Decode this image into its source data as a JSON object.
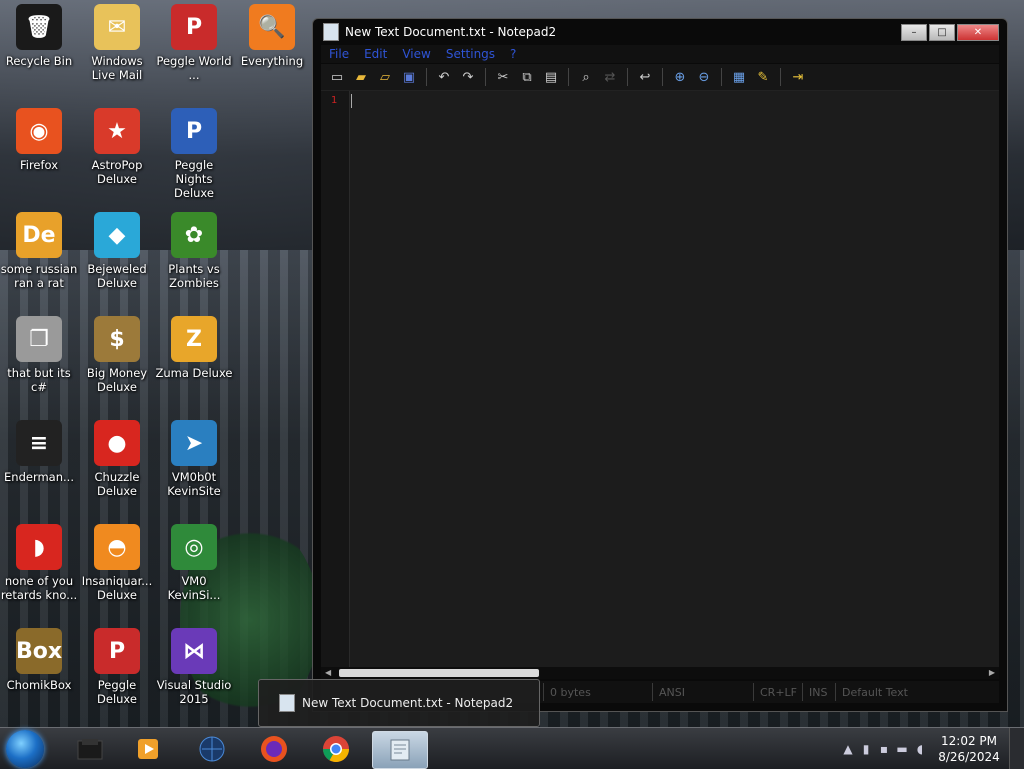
{
  "desktop": {
    "icons": [
      {
        "label": "Recycle Bin",
        "icon": "recycle-bin-icon",
        "color": "#1a1a1a",
        "glyph": "🗑"
      },
      {
        "label": "Windows Live Mail",
        "icon": "mail-icon",
        "color": "#e8c25a",
        "glyph": "✉"
      },
      {
        "label": "Peggle World ...",
        "icon": "peggle-icon",
        "color": "#c92b2b",
        "glyph": "P"
      },
      {
        "label": "Everything",
        "icon": "magnifier-icon",
        "color": "#f07b1f",
        "glyph": "🔍"
      },
      {
        "label": "Firefox",
        "icon": "firefox-icon",
        "color": "#e8521f",
        "glyph": "◉"
      },
      {
        "label": "AstroPop Deluxe",
        "icon": "astropop-icon",
        "color": "#d93a2a",
        "glyph": "★"
      },
      {
        "label": "Peggle Nights Deluxe",
        "icon": "peggle-nights-icon",
        "color": "#2d5fb8",
        "glyph": "P"
      },
      {
        "label": "some russian ran a rat",
        "icon": "de-app-icon",
        "color": "#e8a12a",
        "glyph": "De"
      },
      {
        "label": "Bejeweled Deluxe",
        "icon": "gem-icon",
        "color": "#2aa8d8",
        "glyph": "◆"
      },
      {
        "label": "Plants vs Zombies",
        "icon": "plant-icon",
        "color": "#3a8a2a",
        "glyph": "✿"
      },
      {
        "label": "that but its c#",
        "icon": "windows-stack-icon",
        "color": "#9a9a9a",
        "glyph": "❐"
      },
      {
        "label": "Big Money Deluxe",
        "icon": "money-bag-icon",
        "color": "#9c7a3a",
        "glyph": "$"
      },
      {
        "label": "Zuma Deluxe",
        "icon": "zuma-icon",
        "color": "#e8a62a",
        "glyph": "Z"
      },
      {
        "label": "Enderman...",
        "icon": "console-icon",
        "color": "#222222",
        "glyph": "≡"
      },
      {
        "label": "Chuzzle Deluxe",
        "icon": "chuzzle-icon",
        "color": "#d8261f",
        "glyph": "●"
      },
      {
        "label": "VM0b0t KevinSite",
        "icon": "bird-icon",
        "color": "#2a7fc0",
        "glyph": "➤"
      },
      {
        "label": "none of you retards kno...",
        "icon": "dragon-icon",
        "color": "#d8261f",
        "glyph": "◗"
      },
      {
        "label": "Insaniquar... Deluxe",
        "icon": "fish-icon",
        "color": "#f08a1f",
        "glyph": "◓"
      },
      {
        "label": "VM0 KevinSi...",
        "icon": "chrome-icon",
        "color": "#2f8a3a",
        "glyph": "◎"
      },
      {
        "label": "ChomikBox",
        "icon": "chomikbox-icon",
        "color": "#8a6a2a",
        "glyph": "Box"
      },
      {
        "label": "Peggle Deluxe",
        "icon": "peggle-deluxe-icon",
        "color": "#c92b2b",
        "glyph": "P"
      },
      {
        "label": "Visual Studio 2015",
        "icon": "visual-studio-icon",
        "color": "#6a3ab8",
        "glyph": "⋈"
      }
    ]
  },
  "window": {
    "title": "New Text Document.txt - Notepad2",
    "minimize": "–",
    "maximize": "□",
    "close": "✕",
    "menu": [
      "File",
      "Edit",
      "View",
      "Settings",
      "?"
    ],
    "toolbar": [
      "new-icon",
      "open-icon",
      "browse-icon",
      "save-icon",
      "undo-icon",
      "redo-icon",
      "cut-icon",
      "copy-icon",
      "paste-icon",
      "find-icon",
      "replace-icon",
      "wordwrap-icon",
      "zoom-in-icon",
      "zoom-out-icon",
      "scheme-icon",
      "customize-icon",
      "exit-icon"
    ],
    "line_number": "1",
    "status": {
      "size": "0 bytes",
      "encoding": "ANSI",
      "eol": "CR+LF",
      "ins": "INS",
      "scheme": "Default Text"
    }
  },
  "preview": {
    "title": "New Text Document.txt - Notepad2"
  },
  "taskbar": {
    "apps": [
      "explorer-icon",
      "media-player-icon",
      "globe-icon",
      "firefox-icon",
      "chrome-icon",
      "notepad2-icon"
    ],
    "clock_time": "12:02 PM",
    "clock_date": "8/26/2024"
  }
}
